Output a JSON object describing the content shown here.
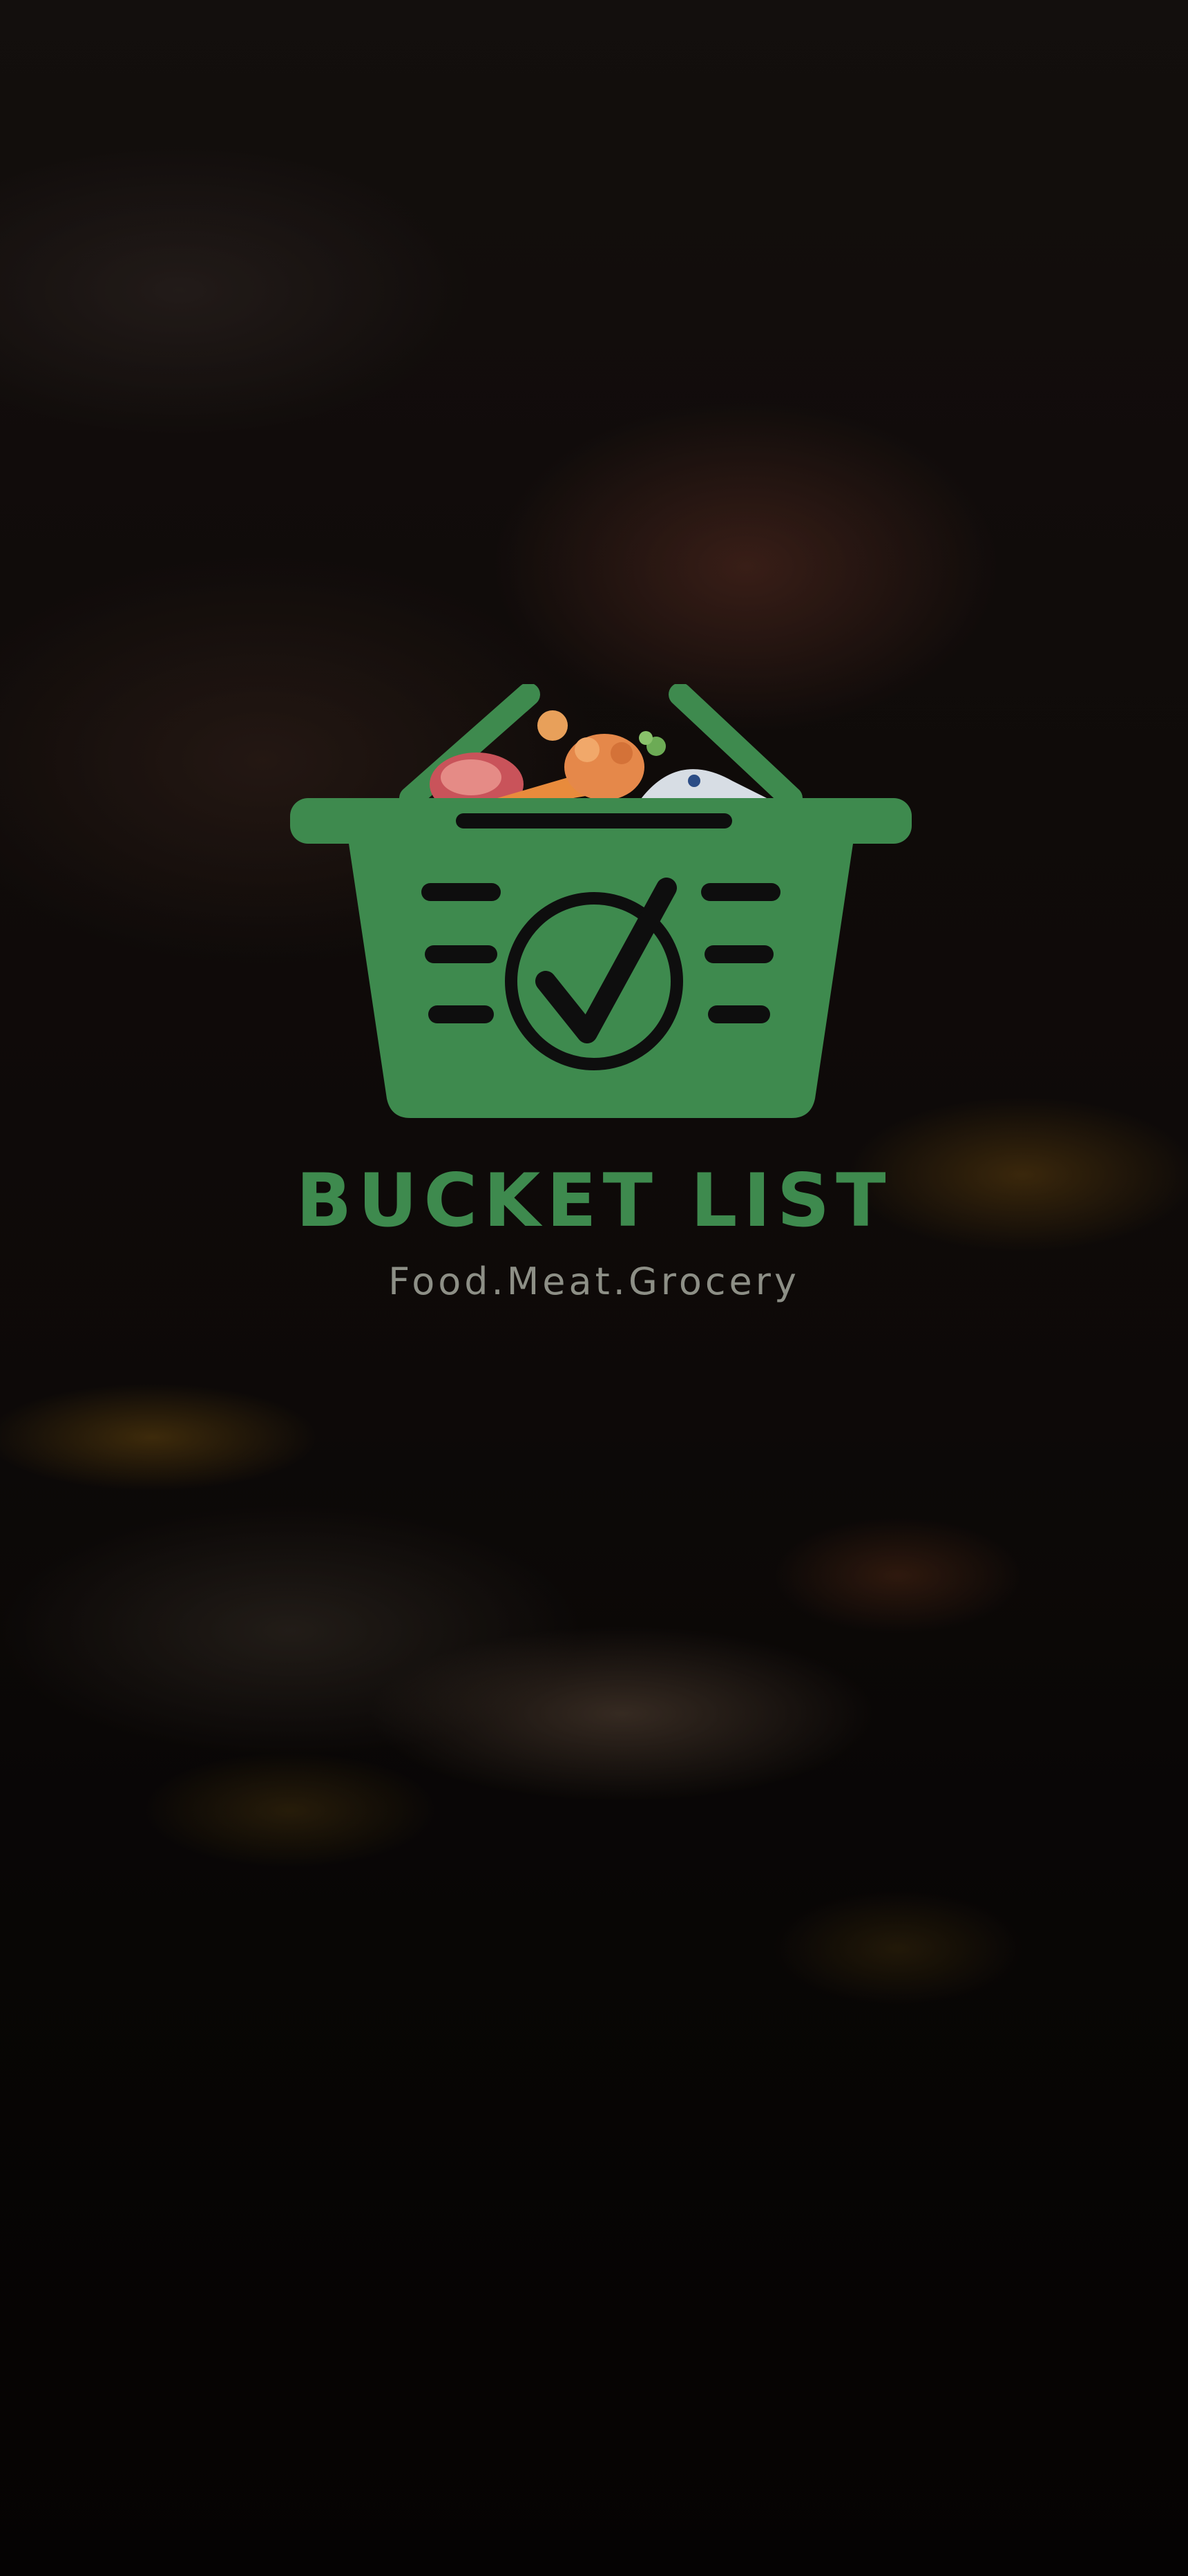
{
  "splash": {
    "brand_name": "BUCKET LIST",
    "tagline": "Food.Meat.Grocery"
  },
  "logo": {
    "icon": "shopping-basket-checkmark-icon",
    "accent_color": "#3e8a4e",
    "mark_color": "#0e0e0e"
  },
  "background": {
    "description_icon": "blurred-food-photo"
  }
}
